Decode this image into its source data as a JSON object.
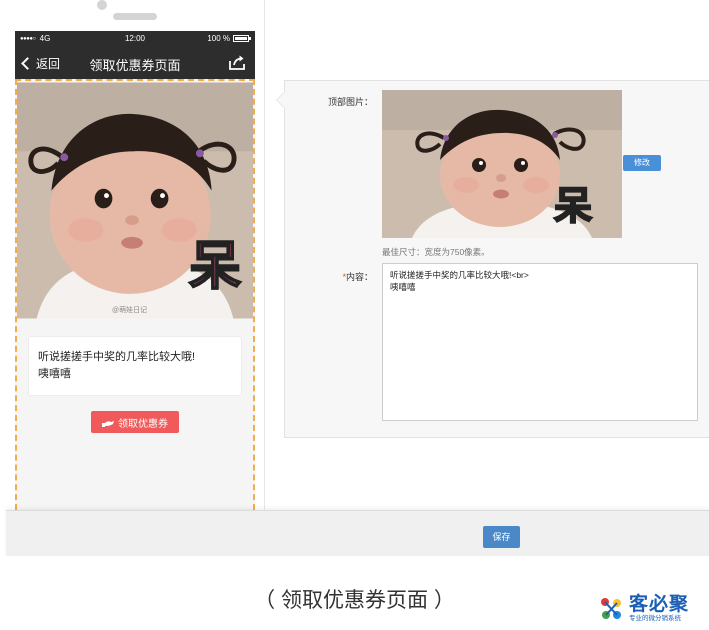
{
  "phone": {
    "status": {
      "carrier": "4G",
      "time": "12:00",
      "battery": "100 %"
    },
    "nav": {
      "back_label": "返回",
      "title": "领取优惠券页面"
    },
    "image": {
      "sticker_char": "呆",
      "watermark": "@萌娃日记"
    },
    "content_lines": [
      "听说搓搓手中奖的几率比较大哦!",
      "咦嘻嘻"
    ],
    "coupon_button": "领取优惠券"
  },
  "editor": {
    "top_image_label": "顶部图片：",
    "edit_button": "修改",
    "size_hint": "最佳尺寸：宽度为750像素。",
    "content_required": "*",
    "content_label": "内容：",
    "content_value": "听说搓搓手中奖的几率比较大哦!<br>\n咦嘻嘻"
  },
  "save_button": "保存",
  "caption": "（ 领取优惠券页面 ）",
  "logo": {
    "name": "客必聚",
    "slogan": "专业的微分销系统"
  },
  "colors": {
    "phone_bar": "#2d2d2d",
    "dashed_border": "#f0ad4e",
    "coupon_red": "#f05a5a",
    "button_blue": "#4a88c8",
    "logo_blue": "#1a5fb4"
  }
}
